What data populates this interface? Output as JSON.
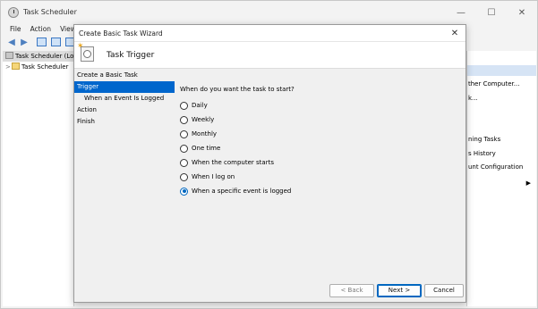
{
  "app": {
    "title": "Task Scheduler"
  },
  "menu": [
    "File",
    "Action",
    "View"
  ],
  "tree": [
    {
      "label": "Task Scheduler (Loc",
      "selected": true
    },
    {
      "label": "Task Scheduler",
      "twisty": ">"
    }
  ],
  "actions_pane": {
    "items": [
      "ther Computer...",
      "k...",
      "",
      "",
      "ning Tasks",
      "s History",
      "unt Configuration"
    ]
  },
  "dialog": {
    "title": "Create Basic Task Wizard",
    "header_title": "Task Trigger",
    "steps": [
      {
        "label": "Create a Basic Task"
      },
      {
        "label": "Trigger",
        "active": true
      },
      {
        "label": "When an Event Is Logged",
        "sub": true
      },
      {
        "label": "Action"
      },
      {
        "label": "Finish"
      }
    ],
    "question": "When do you want the task to start?",
    "options": [
      {
        "label": "Daily",
        "checked": false
      },
      {
        "label": "Weekly",
        "checked": false
      },
      {
        "label": "Monthly",
        "checked": false
      },
      {
        "label": "One time",
        "checked": false
      },
      {
        "label": "When the computer starts",
        "checked": false
      },
      {
        "label": "When I log on",
        "checked": false
      },
      {
        "label": "When a specific event is logged",
        "checked": true
      }
    ],
    "buttons": {
      "back": "< Back",
      "next": "Next >",
      "cancel": "Cancel"
    }
  },
  "icons": {
    "app": "task-scheduler-icon",
    "minimize": "minimize-icon",
    "maximize": "maximize-icon",
    "close": "close-icon",
    "back": "back-arrow-icon",
    "forward": "forward-arrow-icon",
    "header": "task-trigger-wizard-icon"
  },
  "colors": {
    "accent": "#0066cc",
    "radio": "#0067c0"
  }
}
